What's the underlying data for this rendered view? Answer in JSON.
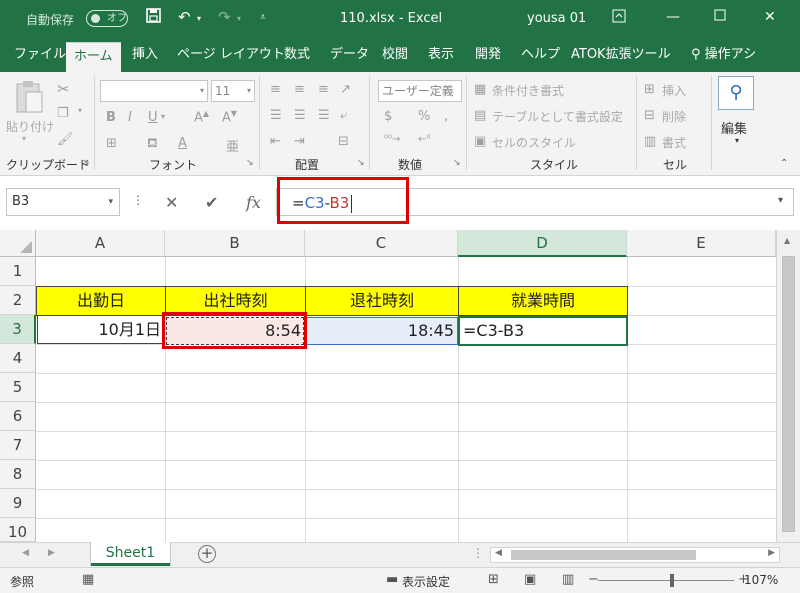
{
  "titlebar": {
    "autosave_label": "自動保存",
    "autosave_state": "オフ",
    "document_title": "110.xlsx  -  Excel",
    "user_name": "yousa 01"
  },
  "ribbon_tabs": [
    "ファイル",
    "ホーム",
    "挿入",
    "ページ レイアウト",
    "数式",
    "データ",
    "校閲",
    "表示",
    "開発",
    "ヘルプ",
    "ATOK拡張ツール",
    "操作アシ"
  ],
  "active_tab": "ホーム",
  "ribbon": {
    "clipboard": {
      "paste_label": "貼り付け",
      "group_label": "クリップボード"
    },
    "font": {
      "font_name": "",
      "font_size": "11",
      "group_label": "フォント"
    },
    "alignment": {
      "group_label": "配置"
    },
    "number": {
      "format": "ユーザー定義",
      "group_label": "数値"
    },
    "styles": {
      "conditional_formatting": "条件付き書式",
      "format_as_table": "テーブルとして書式設定",
      "cell_styles": "セルのスタイル",
      "group_label": "スタイル"
    },
    "cells": {
      "insert": "挿入",
      "delete": "削除",
      "format": "書式",
      "group_label": "セル"
    },
    "editing": {
      "label": "編集"
    }
  },
  "formula_bar": {
    "name_box": "B3",
    "cancel_icon": "✕",
    "enter_icon": "✔",
    "function_icon": "fx",
    "formula_eq": "=",
    "formula_ref1": "C3",
    "formula_op": "-",
    "formula_ref2": "B3"
  },
  "columns": [
    "A",
    "B",
    "C",
    "D",
    "E"
  ],
  "selected_column": "D",
  "rows": [
    "1",
    "2",
    "3",
    "4",
    "5",
    "6",
    "7",
    "8",
    "9",
    "10"
  ],
  "selected_row": "3",
  "cells": {
    "A2": "出勤日",
    "B2": "出社時刻",
    "C2": "退社時刻",
    "D2": "就業時間",
    "A3": "10月1日",
    "B3": "8:54",
    "C3": "18:45",
    "D3": "=C3-B3"
  },
  "sheet_tabs": [
    "Sheet1"
  ],
  "statusbar": {
    "mode": "参照",
    "display_settings": "表示設定",
    "zoom_percent": "107%"
  },
  "colors": {
    "excel_green": "#217346",
    "highlight_red": "#e00000",
    "header_yellow": "#ffff00",
    "ref_blue": "#3b6ecb",
    "ref_red": "#c0392b"
  },
  "icons": {
    "save": "save-icon",
    "undo": "undo-icon",
    "redo": "redo-icon",
    "search": "search-icon",
    "add_sheet": "plus-circle-icon"
  }
}
